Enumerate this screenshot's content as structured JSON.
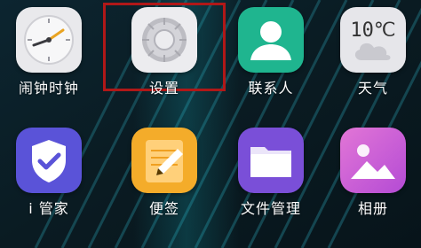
{
  "apps": [
    {
      "key": "clock",
      "label": "闹钟时钟",
      "icon": "clock-icon"
    },
    {
      "key": "settings",
      "label": "设置",
      "icon": "gear-icon"
    },
    {
      "key": "contacts",
      "label": "联系人",
      "icon": "person-icon"
    },
    {
      "key": "weather",
      "label": "天气",
      "icon": "weather-icon",
      "temp": "10℃"
    },
    {
      "key": "security",
      "label": "i 管家",
      "icon": "shield-check-icon"
    },
    {
      "key": "notes",
      "label": "便签",
      "icon": "pencil-note-icon"
    },
    {
      "key": "files",
      "label": "文件管理",
      "icon": "folder-icon"
    },
    {
      "key": "gallery",
      "label": "相册",
      "icon": "photo-icon"
    }
  ],
  "colors": {
    "selection_box": "#b01818",
    "contacts": "#1fb58f",
    "security": "#5a53d8",
    "notes": "#f4ac2a",
    "files": "#7a4fd8",
    "gallery": "#d36ad6"
  }
}
